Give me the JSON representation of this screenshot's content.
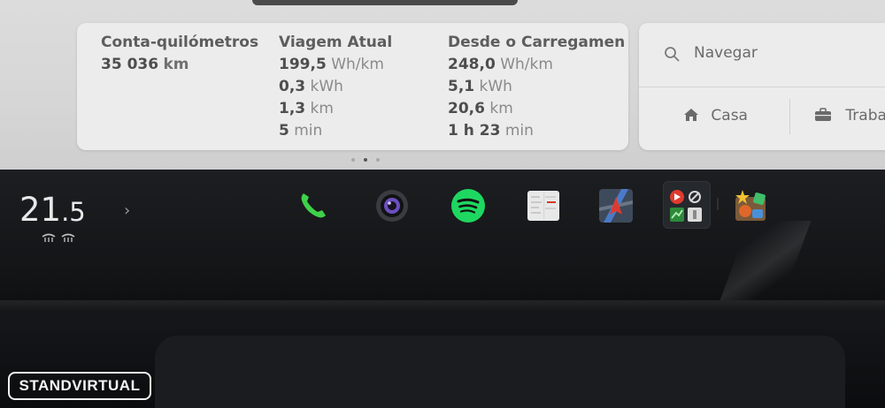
{
  "trip": {
    "odometer": {
      "title": "Conta-quilómetros",
      "value": "35 036",
      "unit": "km"
    },
    "current_trip": {
      "title": "Viagem Atual",
      "rows": [
        {
          "value": "199,5",
          "unit": "Wh/km"
        },
        {
          "value": "0,3",
          "unit": "kWh"
        },
        {
          "value": "1,3",
          "unit": "km"
        },
        {
          "value": "5",
          "unit": "min"
        }
      ]
    },
    "since_charge": {
      "title": "Desde o Carregamen",
      "rows": [
        {
          "value": "248,0",
          "unit": "Wh/km"
        },
        {
          "value": "5,1",
          "unit": "kWh"
        },
        {
          "value": "20,6",
          "unit": "km"
        },
        {
          "value": "1 h 23",
          "unit": "min"
        }
      ]
    }
  },
  "pager": {
    "pages": 3,
    "active_index": 1
  },
  "navigation": {
    "search_placeholder": "Navegar",
    "shortcuts": [
      {
        "icon": "home-icon",
        "label": "Casa"
      },
      {
        "icon": "briefcase-icon",
        "label": "Traba"
      }
    ]
  },
  "climate": {
    "temp_int": "21",
    "temp_dec": ".5"
  },
  "dock": {
    "apps": [
      {
        "name": "phone-icon",
        "color": "#3fd14a"
      },
      {
        "name": "camera-icon",
        "color": "#8a6fd6"
      },
      {
        "name": "spotify-icon",
        "color": "#1ed760"
      },
      {
        "name": "calendar-icon",
        "color": "#e8e8e8"
      },
      {
        "name": "maps-icon",
        "color": "#d63b2f"
      },
      {
        "name": "app-launcher-icon",
        "color": "#4aa3df"
      },
      {
        "name": "toybox-icon",
        "color": "#f0a030"
      }
    ]
  },
  "watermark": {
    "text": "STANDVIRTUAL"
  }
}
